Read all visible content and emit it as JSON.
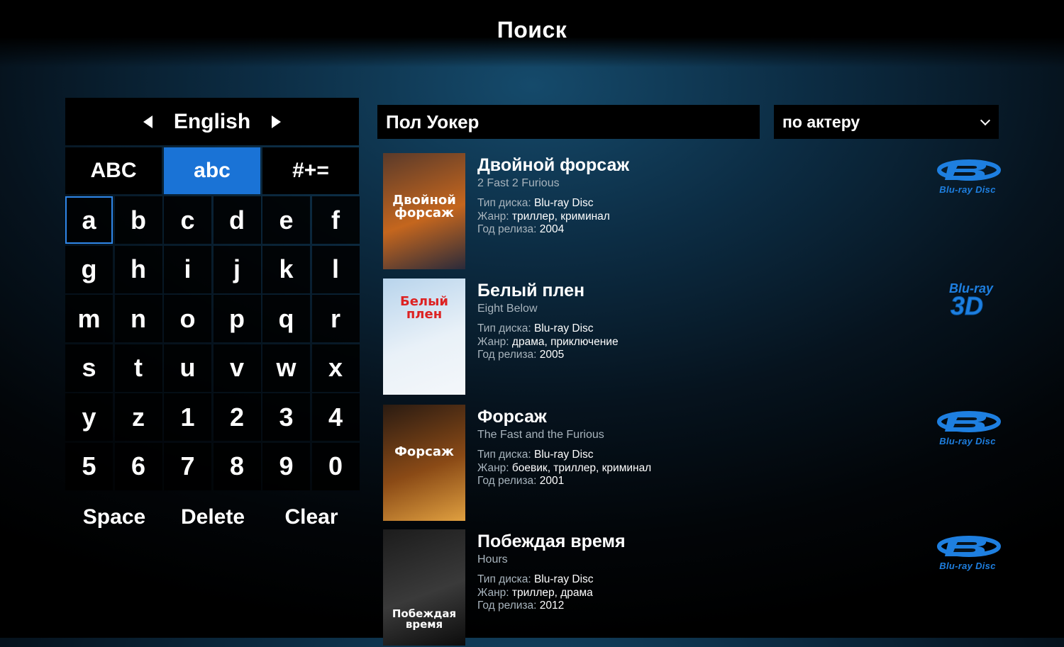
{
  "header": {
    "title": "Поиск"
  },
  "keyboard": {
    "language": "English",
    "modes": [
      "ABC",
      "abc",
      "#+="
    ],
    "active_mode": "abc",
    "selected_key": "a",
    "keys": [
      "a",
      "b",
      "c",
      "d",
      "e",
      "f",
      "g",
      "h",
      "i",
      "j",
      "k",
      "l",
      "m",
      "n",
      "o",
      "p",
      "q",
      "r",
      "s",
      "t",
      "u",
      "v",
      "w",
      "x",
      "y",
      "z",
      "1",
      "2",
      "3",
      "4",
      "5",
      "6",
      "7",
      "8",
      "9",
      "0"
    ],
    "actions": [
      "Space",
      "Delete",
      "Clear"
    ]
  },
  "search": {
    "query": "Пол Уокер",
    "filter": "по актеру"
  },
  "labels": {
    "disc_type": "Тип диска:",
    "genre": "Жанр:",
    "year": "Год релиза:"
  },
  "results": [
    {
      "title": "Двойной форсаж",
      "original_title": "2 Fast 2 Furious",
      "disc_type": "Blu-ray Disc",
      "genre": "триллер, криминал",
      "year": "2004",
      "badge": "bluray-disc",
      "poster_text": "Двойной форсаж",
      "poster_colors": [
        "#5a3a2a",
        "#c4661e",
        "#2a2a3a"
      ]
    },
    {
      "title": "Белый плен",
      "original_title": "Eight Below",
      "disc_type": "Blu-ray Disc",
      "genre": "драма, приключение",
      "year": "2005",
      "badge": "bluray-3d",
      "poster_text": "Белый плен",
      "poster_colors": [
        "#b8d4ec",
        "#e9f1f8",
        "#f4f7fa"
      ]
    },
    {
      "title": "Форсаж",
      "original_title": "The Fast and the Furious",
      "disc_type": "Blu-ray Disc",
      "genre": "боевик, триллер, криминал",
      "year": "2001",
      "badge": "bluray-disc",
      "poster_text": "Форсаж",
      "poster_colors": [
        "#2a1b12",
        "#8a4a16",
        "#e0a040"
      ]
    },
    {
      "title": "Побеждая время",
      "original_title": "Hours",
      "disc_type": "Blu-ray Disc",
      "genre": "триллер, драма",
      "year": "2012",
      "badge": "bluray-disc",
      "poster_text": "Побеждая время",
      "poster_colors": [
        "#1c1c1c",
        "#3a3a3a",
        "#0c0c0c"
      ]
    }
  ],
  "badges": {
    "bluray_disc_text": "Blu-ray Disc",
    "bluray_3d_text": "Blu-ray",
    "bluray_3d_big": "3D"
  },
  "colors": {
    "accent": "#1a73d6",
    "badge_blue": "#1e7fe0"
  }
}
